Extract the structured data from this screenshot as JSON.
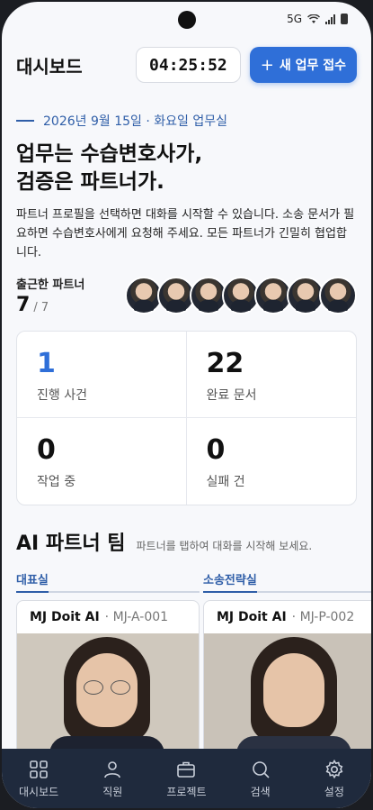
{
  "status": {
    "network": "5G"
  },
  "header": {
    "title": "대시보드",
    "clock": "04:25:52",
    "new_button": "새 업무 접수",
    "new_icon": "plus-icon"
  },
  "hero": {
    "date_line": "2026년 9월 15일 · 화요일 업무실",
    "headline_1": "업무는 수습변호사가,",
    "headline_2": "검증은 파트너가.",
    "description": "파트너 프로필을 선택하면 대화를 시작할 수 있습니다. 소송 문서가 필요하면 수습변호사에게 요청해 주세요. 모든 파트너가 긴밀히 협업합니다."
  },
  "partners": {
    "label": "출근한 파트너",
    "count": "7",
    "total": "/ 7",
    "avatars": 7
  },
  "stats": [
    {
      "value": "1",
      "label": "진행 사건"
    },
    {
      "value": "22",
      "label": "완료 문서"
    },
    {
      "value": "0",
      "label": "작업 중"
    },
    {
      "value": "0",
      "label": "실패 건"
    }
  ],
  "team": {
    "title": "AI 파트너 팀",
    "hint": "파트너를 탭하여 대화를 시작해 보세요.",
    "groups": [
      {
        "label": "대표실",
        "card_name": "MJ Doit AI",
        "card_code": "· MJ-A-001"
      },
      {
        "label": "소송전략실",
        "card_name": "MJ Doit AI",
        "card_code": "· MJ-P-002"
      }
    ]
  },
  "tabbar": [
    {
      "label": "대시보드",
      "icon": "grid-icon"
    },
    {
      "label": "직원",
      "icon": "person-icon"
    },
    {
      "label": "프로젝트",
      "icon": "briefcase-icon"
    },
    {
      "label": "검색",
      "icon": "search-icon"
    },
    {
      "label": "설정",
      "icon": "gear-icon"
    }
  ],
  "colors": {
    "accent": "#2f6fd8",
    "tabbar_bg": "#1f2a3d"
  }
}
